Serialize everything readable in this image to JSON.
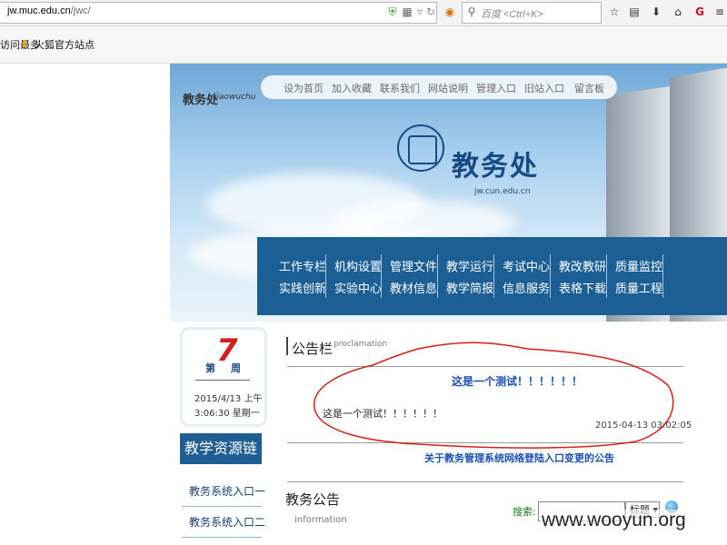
{
  "browser": {
    "url_host": "jw.muc.edu.cn",
    "url_path": "/jwc/",
    "search_placeholder": "百度 <Ctrl+K>",
    "bookmarks": [
      "访问最多",
      "火狐官方站点"
    ]
  },
  "header": {
    "brand": "教务处",
    "brand_pinyin": "jiaowuchu",
    "logo_text": "教务处",
    "logo_url": "jw.cun.edu.cn",
    "top_links": [
      "设为首页",
      "加入收藏",
      "联系我们",
      "网站说明",
      "管理入口",
      "旧站入口",
      "留言板"
    ]
  },
  "main_nav": {
    "row1": [
      "工作专栏",
      "机构设置",
      "管理文件",
      "教学运行",
      "考试中心",
      "教改教研",
      "质量监控"
    ],
    "row2": [
      "实践创新",
      "实验中心",
      "教材信息",
      "教学简报",
      "信息服务",
      "表格下载",
      "质量工程"
    ]
  },
  "date_widget": {
    "week_prefix": "第",
    "week_number": "7",
    "week_suffix": "周",
    "date_line1": "2015/4/13 上午",
    "date_line2": "3:06:30 星期一"
  },
  "resources": {
    "title": "教学资源链接",
    "links": [
      "教务系统入口一",
      "教务系统入口二"
    ]
  },
  "notice": {
    "title": "公告栏",
    "title_en": "proclamation",
    "headline": "这是一个测试！！！！！！",
    "body": "这是一个测试！！！！！！",
    "date": "2015-04-13 03:02:05",
    "link": "关于教务管理系统网络登陆入口变更的公告"
  },
  "teaching_notice": {
    "title": "教务公告",
    "title_en": "information",
    "search_label": "搜索:",
    "search_value": "",
    "select_value": "标题"
  },
  "watermark": "www.wooyun.org",
  "colors": {
    "nav_bg": "#1c5f95",
    "link_blue": "#1b4fb3",
    "annotation_red": "#d62020"
  }
}
